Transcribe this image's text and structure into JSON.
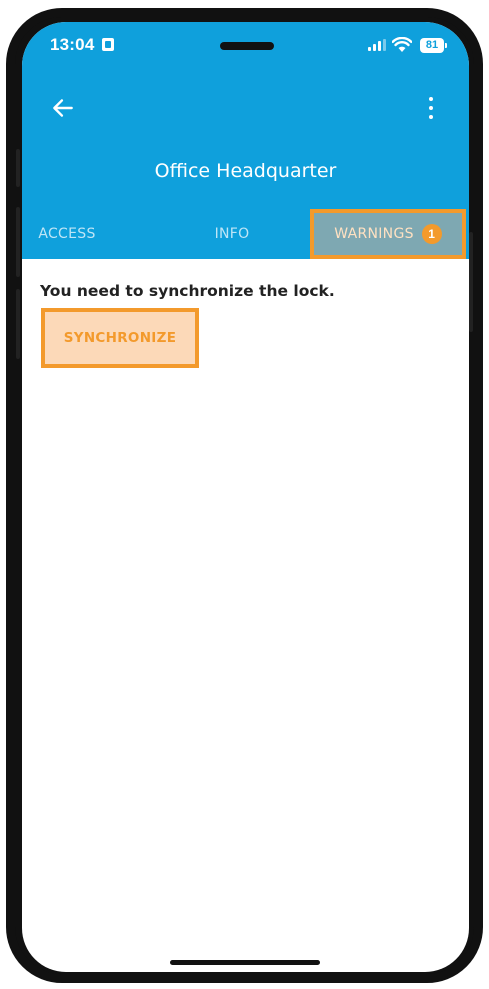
{
  "status_bar": {
    "time": "13:04",
    "battery": "81",
    "icons": [
      "sim-card-icon",
      "signal-icon",
      "wifi-icon",
      "battery-icon"
    ]
  },
  "app_bar": {
    "back_icon": "arrow-left-icon",
    "menu_icon": "more-vertical-icon",
    "title": "Office Headquarter",
    "background": "#0fa0dc"
  },
  "tabs": {
    "access": "ACCESS",
    "info": "INFO",
    "warnings": "WARNINGS",
    "warnings_badge": "1",
    "selected": "WARNINGS"
  },
  "content": {
    "message": "You need to synchronize the lock.",
    "sync_button": "SYNCHRONIZE"
  },
  "colors": {
    "highlight": "#f39a2c",
    "highlight_fill": "#fcd9b8",
    "primary": "#0fa0dc"
  }
}
